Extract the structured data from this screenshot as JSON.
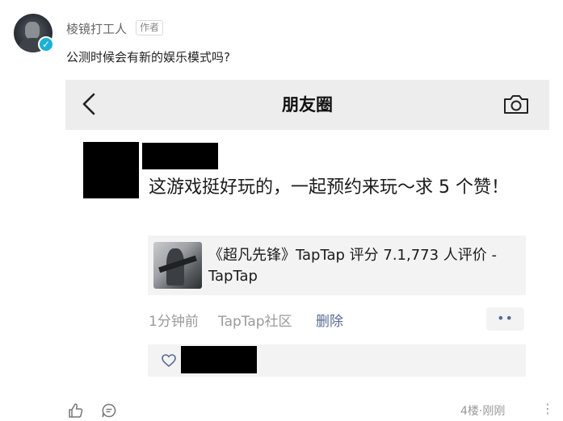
{
  "comment": {
    "username": "棱镜打工人",
    "author_tag": "作者",
    "text": "公测时候会有新的娱乐模式吗?",
    "verified_badge": "✓",
    "floor": "4楼",
    "separator": "·",
    "time": "刚刚",
    "menu_glyph": "⋮"
  },
  "moments": {
    "title": "朋友圈",
    "post_text": "这游戏挺好玩的，一起预约来玩～求 5 个赞！",
    "link_title": "《超凡先锋》TapTap 评分 7.1,773 人评价 - TapTap",
    "time": "1分钟前",
    "source": "TapTap社区",
    "delete_label": "删除",
    "more_glyph": "••"
  },
  "colors": {
    "header_bg": "#ededed",
    "link_blue": "#576b95",
    "meta_gray": "#9a9a9a",
    "card_bg": "#f3f3f3",
    "badge_blue": "#1bb0d6"
  },
  "icons": [
    "back-arrow-icon",
    "camera-icon",
    "heart-icon",
    "like-icon",
    "reply-icon",
    "more-dots-icon",
    "verified-icon"
  ]
}
